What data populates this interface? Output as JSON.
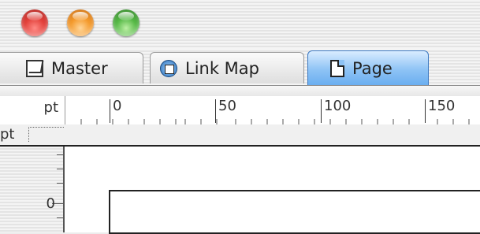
{
  "tabs": [
    {
      "label": "Master",
      "icon": "master-page-icon"
    },
    {
      "label": "Link Map",
      "icon": "link-map-icon"
    },
    {
      "label": "Page",
      "icon": "page-icon",
      "selected": true
    }
  ],
  "ruler": {
    "unit": "pt",
    "horizontal_labels": [
      "0",
      "50",
      "100",
      "150"
    ],
    "vertical_unit": "pt",
    "vertical_labels": [
      "0"
    ]
  },
  "colors": {
    "selected_tab": "#8ec3f5",
    "close_button": "#e2403a",
    "minimize_button": "#f49a2c",
    "zoom_button": "#55b845"
  }
}
